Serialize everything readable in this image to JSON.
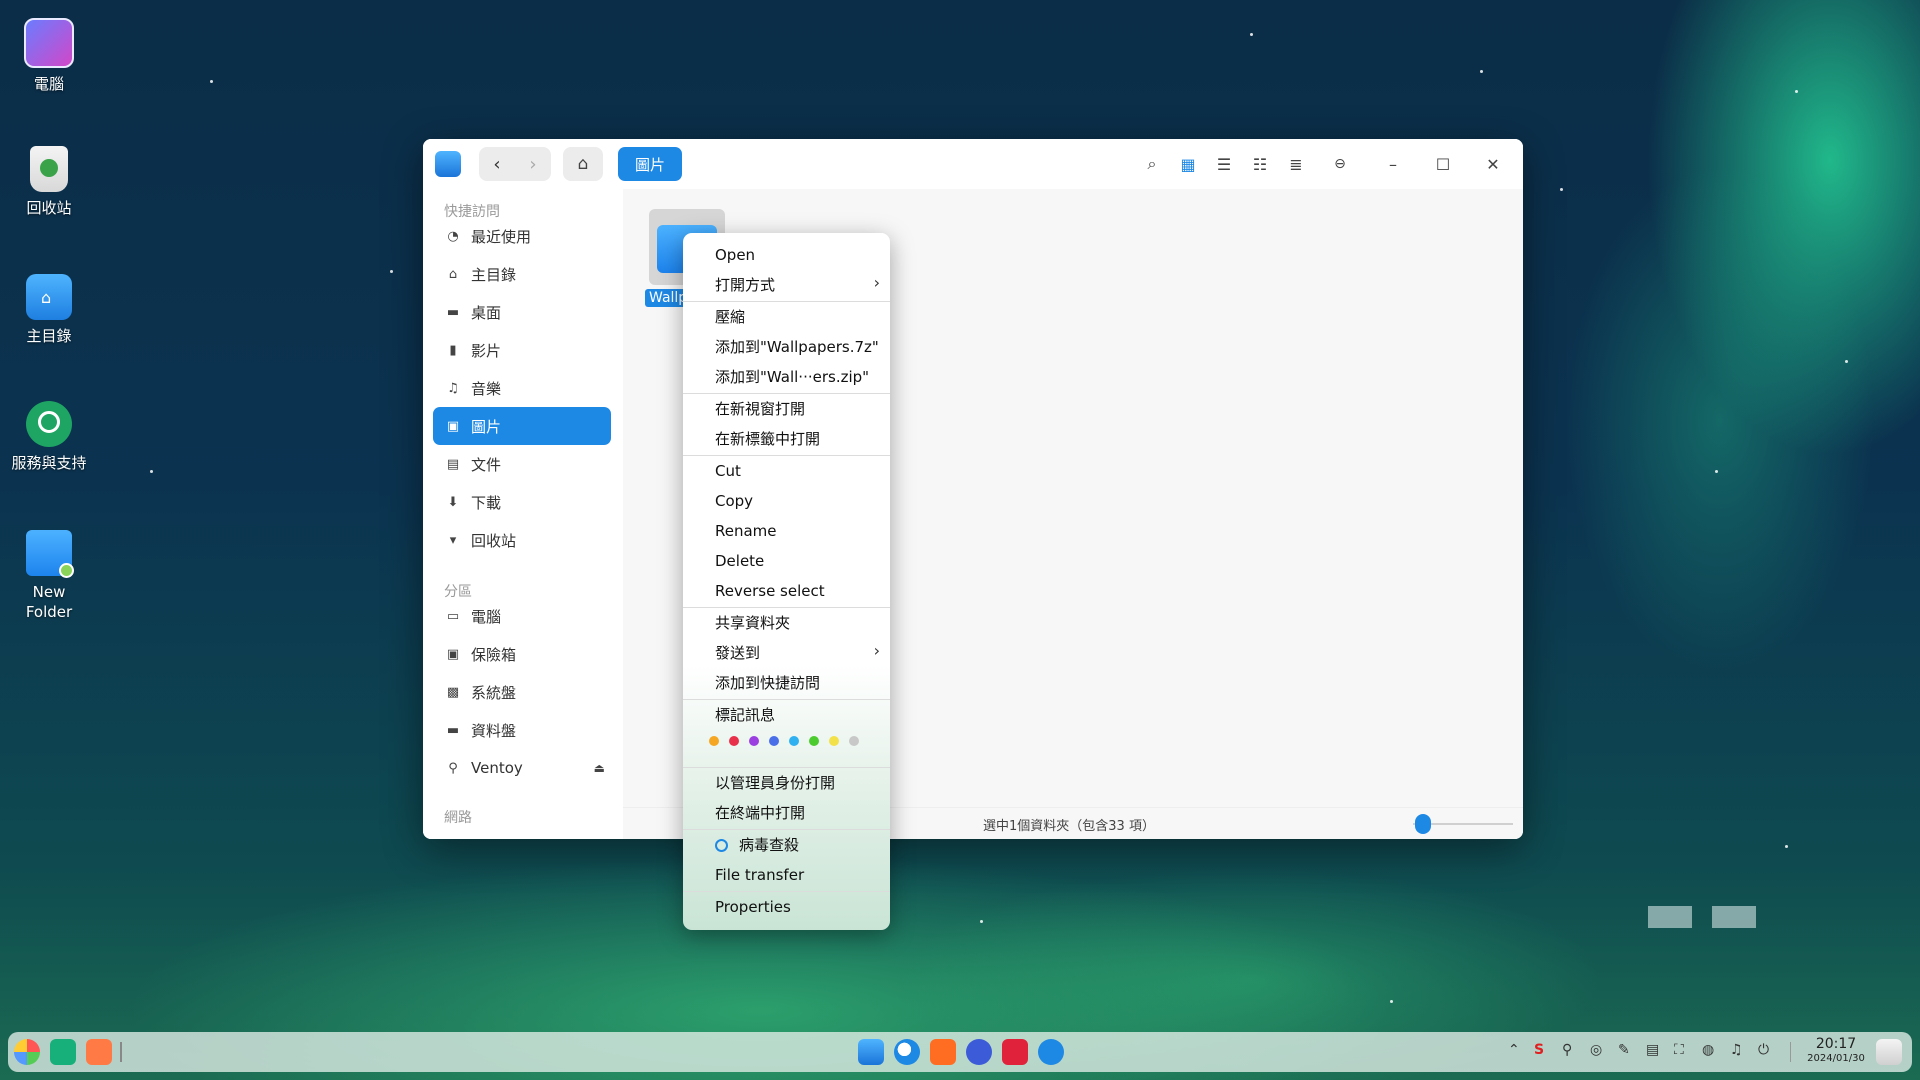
{
  "desktop": {
    "icons": [
      {
        "label": "電腦",
        "icon": "computer-icon"
      },
      {
        "label": "回收站",
        "icon": "trash-icon"
      },
      {
        "label": "主目錄",
        "icon": "home-folder-icon"
      },
      {
        "label": "服務與支持",
        "icon": "support-icon"
      },
      {
        "label": "New Folder",
        "icon": "folder-icon"
      }
    ]
  },
  "window": {
    "breadcrumb": "圖片",
    "sidebar": {
      "quick_access_title": "快捷訪問",
      "quick_items": [
        {
          "label": "最近使用",
          "icon": "clock-icon"
        },
        {
          "label": "主目錄",
          "icon": "home-icon"
        },
        {
          "label": "桌面",
          "icon": "desktop-icon"
        },
        {
          "label": "影片",
          "icon": "video-icon"
        },
        {
          "label": "音樂",
          "icon": "music-icon"
        },
        {
          "label": "圖片",
          "icon": "picture-icon",
          "active": true
        },
        {
          "label": "文件",
          "icon": "document-icon"
        },
        {
          "label": "下載",
          "icon": "download-icon"
        },
        {
          "label": "回收站",
          "icon": "trash-icon"
        }
      ],
      "partition_title": "分區",
      "partition_items": [
        {
          "label": "電腦",
          "icon": "computer-icon"
        },
        {
          "label": "保險箱",
          "icon": "vault-icon"
        },
        {
          "label": "系統盤",
          "icon": "system-disk-icon"
        },
        {
          "label": "資料盤",
          "icon": "data-disk-icon"
        },
        {
          "label": "Ventoy",
          "icon": "usb-icon",
          "eject": "⏏"
        }
      ],
      "network_title": "網路"
    },
    "content": {
      "folder_label": "Wallp"
    },
    "status": "選中1個資料夾（包含33 項）"
  },
  "context_menu": {
    "items": {
      "open": "Open",
      "open_with": "打開方式",
      "compress": "壓縮",
      "add_7z": "添加到\"Wallpapers.7z\"",
      "add_zip": "添加到\"Wall···ers.zip\"",
      "open_new_window": "在新視窗打開",
      "open_new_tab": "在新標籤中打開",
      "cut": "Cut",
      "copy": "Copy",
      "rename": "Rename",
      "delete": "Delete",
      "reverse_select": "Reverse select",
      "share_folder": "共享資料夾",
      "send_to": "發送到",
      "add_quick_access": "添加到快捷訪問",
      "tag_info": "標記訊息",
      "open_as_admin": "以管理員身份打開",
      "open_in_terminal": "在終端中打開",
      "virus_scan": "病毒查殺",
      "file_transfer": "File transfer",
      "properties": "Properties"
    },
    "tag_colors": [
      "#f5a623",
      "#e8304b",
      "#9b3fe0",
      "#4a6ee8",
      "#2fb0f0",
      "#4ccb2f",
      "#f3e14a",
      "#c8c8c8"
    ]
  },
  "taskbar": {
    "clock_time": "20:17",
    "clock_date": "2024/01/30"
  }
}
